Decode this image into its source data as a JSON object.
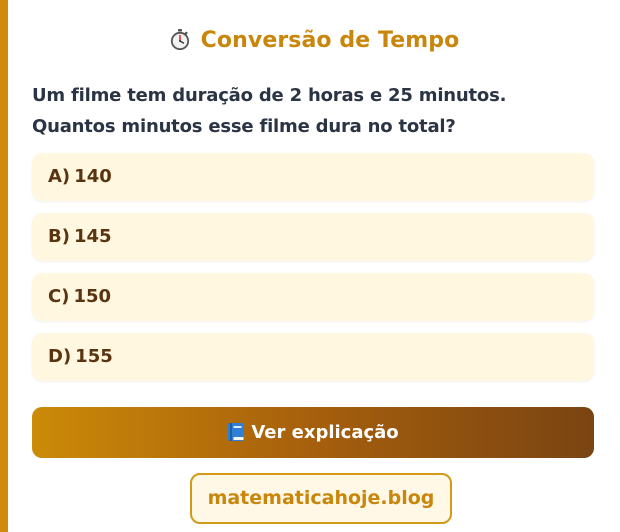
{
  "quiz": {
    "title_icon": "stopwatch-icon",
    "title": "Conversão de Tempo",
    "question_line1": "Um filme tem duração de 2 horas e 25 minutos.",
    "question_line2": "Quantos minutos esse filme dura no total?",
    "options": [
      {
        "letter": "A)",
        "value": "140"
      },
      {
        "letter": "B)",
        "value": "145"
      },
      {
        "letter": "C)",
        "value": "150"
      },
      {
        "letter": "D)",
        "value": "155"
      }
    ],
    "explain_icon": "book-icon",
    "explain_label": "Ver explicação",
    "site_label": "matematicahoje.blog"
  },
  "colors": {
    "accent": "#c8860a",
    "option_bg": "#fff7df",
    "option_text": "#5a3410",
    "question_text": "#2b3444",
    "button_gradient_start": "#cc8a08",
    "button_gradient_end": "#7a4412"
  }
}
